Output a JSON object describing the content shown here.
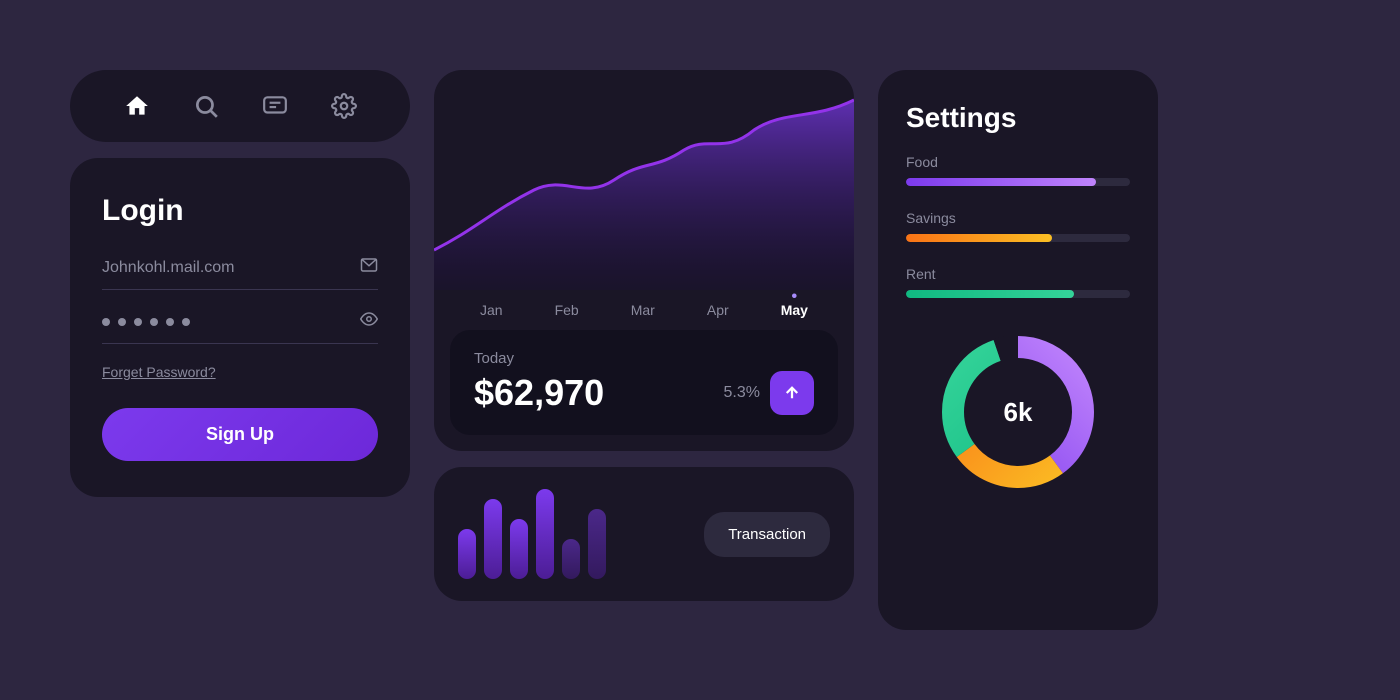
{
  "nav": {
    "icons": [
      {
        "name": "home-icon",
        "symbol": "⌂",
        "active": true
      },
      {
        "name": "search-icon",
        "symbol": "⚲",
        "active": false
      },
      {
        "name": "chat-icon",
        "symbol": "💬",
        "active": false
      },
      {
        "name": "settings-icon",
        "symbol": "⚙",
        "active": false
      }
    ]
  },
  "login": {
    "title": "Login",
    "email_placeholder": "Johnkohl.mail.com",
    "forget_label": "Forget Password?",
    "signup_label": "Sign Up"
  },
  "chart": {
    "months": [
      "Jan",
      "Feb",
      "Mar",
      "Apr",
      "May"
    ],
    "active_month": "May",
    "today_label": "Today",
    "value": "$62,970",
    "percent": "5.3%"
  },
  "transaction": {
    "label": "Transaction"
  },
  "settings": {
    "title": "Settings",
    "items": [
      {
        "label": "Food",
        "percent": 85
      },
      {
        "label": "Savings",
        "percent": 65
      },
      {
        "label": "Rent",
        "percent": 75
      }
    ],
    "donut_value": "6k"
  }
}
